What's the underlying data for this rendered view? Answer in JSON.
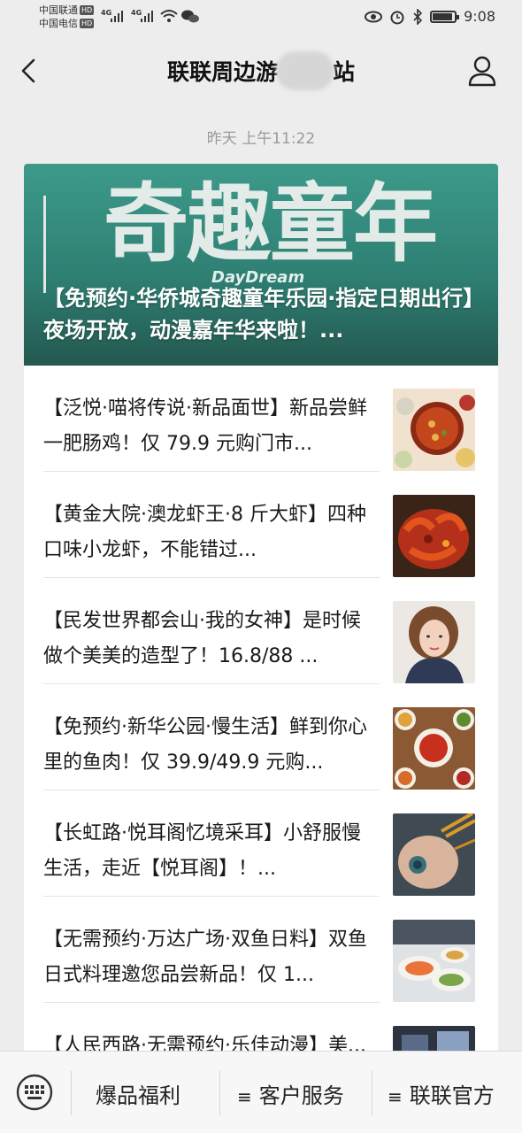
{
  "status": {
    "carrier1": "中国联通",
    "carrier2": "中国电信",
    "hd": "HD",
    "net": "4G",
    "time": "9:08",
    "battery_level": 0.9
  },
  "nav": {
    "title": "联联周边游",
    "title_suffix": "站"
  },
  "timestamp": "昨天 上午11:22",
  "cover": {
    "art_text": "奇趣童年",
    "art_script": "DayDream",
    "title": "【免预约·华侨城奇趣童年乐园·指定日期出行】夜场开放，动漫嘉年华来啦！..."
  },
  "articles": [
    {
      "text": "【泛悦·喵将传说·新品面世】新品尝鲜一肥肠鸡！仅 79.9 元购门市...",
      "thumb": "food"
    },
    {
      "text": "【黄金大院·澳龙虾王·8 斤大虾】四种口味小龙虾，不能错过...",
      "thumb": "crayfish"
    },
    {
      "text": "【民发世界都会山·我的女神】是时候做个美美的造型了！16.8/88 ...",
      "thumb": "portrait"
    },
    {
      "text": "【免预约·新华公园·慢生活】鲜到你心里的鱼肉！仅 39.9/49.9 元购...",
      "thumb": "dishes"
    },
    {
      "text": "【长虹路·悦耳阁忆境采耳】小舒服慢生活，走近【悦耳阁】！...",
      "thumb": "ear"
    },
    {
      "text": "【无需预约·万达广场·双鱼日料】双鱼日式料理邀您品尝新品！仅 1...",
      "thumb": "sushi"
    },
    {
      "text": "【人民西路·无需预约·乐佳动漫】美...",
      "thumb": "partial"
    }
  ],
  "menu": {
    "item1": "爆品福利",
    "item2": "客户服务",
    "item3": "联联官方",
    "ham": "≡"
  }
}
